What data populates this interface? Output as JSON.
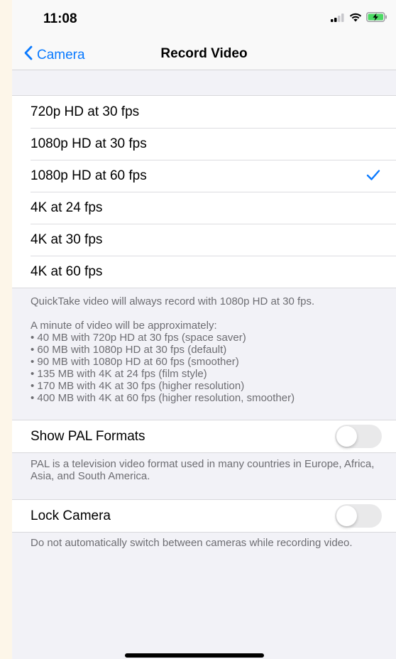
{
  "status_bar": {
    "time": "11:08",
    "icons": [
      "signal-icon",
      "wifi-icon",
      "battery-charging-icon"
    ]
  },
  "nav": {
    "back_label": "Camera",
    "title": "Record Video"
  },
  "options": [
    {
      "label": "720p HD at 30 fps",
      "selected": false
    },
    {
      "label": "1080p HD at 30 fps",
      "selected": false
    },
    {
      "label": "1080p HD at 60 fps",
      "selected": true
    },
    {
      "label": "4K at 24 fps",
      "selected": false
    },
    {
      "label": "4K at 30 fps",
      "selected": false
    },
    {
      "label": "4K at 60 fps",
      "selected": false
    }
  ],
  "quicktake_note": "QuickTake video will always record with 1080p HD at 30 fps.",
  "size_info": {
    "intro": "A minute of video will be approximately:",
    "items": [
      "• 40 MB with 720p HD at 30 fps (space saver)",
      "• 60 MB with 1080p HD at 30 fps (default)",
      "• 90 MB with 1080p HD at 60 fps (smoother)",
      "• 135 MB with 4K at 24 fps (film style)",
      "• 170 MB with 4K at 30 fps (higher resolution)",
      "• 400 MB with 4K at 60 fps (higher resolution, smoother)"
    ]
  },
  "pal": {
    "label": "Show PAL Formats",
    "on": false,
    "description": "PAL is a television video format used in many countries in Europe, Africa, Asia, and South America."
  },
  "lock_camera": {
    "label": "Lock Camera",
    "on": false,
    "description": "Do not automatically switch between cameras while recording video."
  },
  "colors": {
    "accent": "#0a7aff",
    "background": "#f2f2f7",
    "footer_text": "#6d6d72"
  }
}
